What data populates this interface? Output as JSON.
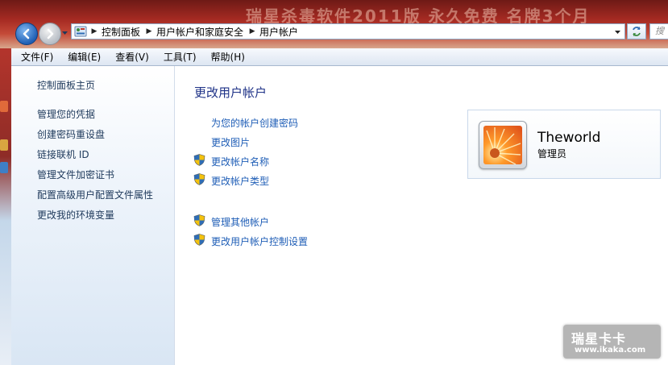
{
  "window": {
    "banner_text": "瑞星杀毒软件2011版 永久免费 名牌3个月",
    "search_placeholder": "搜"
  },
  "address_bar": {
    "crumbs": [
      "控制面板",
      "用户帐户和家庭安全",
      "用户帐户"
    ]
  },
  "menu": {
    "items": [
      "文件(F)",
      "编辑(E)",
      "查看(V)",
      "工具(T)",
      "帮助(H)"
    ]
  },
  "sidebar": {
    "home": "控制面板主页",
    "items": [
      "管理您的凭据",
      "创建密码重设盘",
      "链接联机 ID",
      "管理文件加密证书",
      "配置高级用户配置文件属性",
      "更改我的环境变量"
    ]
  },
  "main": {
    "title": "更改用户帐户",
    "tasks": [
      {
        "label": "为您的帐户创建密码",
        "shield": false
      },
      {
        "label": "更改图片",
        "shield": false
      },
      {
        "label": "更改帐户名称",
        "shield": true
      },
      {
        "label": "更改帐户类型",
        "shield": true
      }
    ],
    "other_tasks": [
      {
        "label": "管理其他帐户",
        "shield": true
      },
      {
        "label": "更改用户帐户控制设置",
        "shield": true
      }
    ]
  },
  "account": {
    "name": "Theworld",
    "role": "管理员"
  },
  "watermark": {
    "title": "瑞星卡卡",
    "url": "www.ikaka.com"
  },
  "colors": {
    "link": "#1e5db6",
    "nav_text": "#1e395b",
    "title": "#1e3287",
    "banner": "#a52a22"
  }
}
